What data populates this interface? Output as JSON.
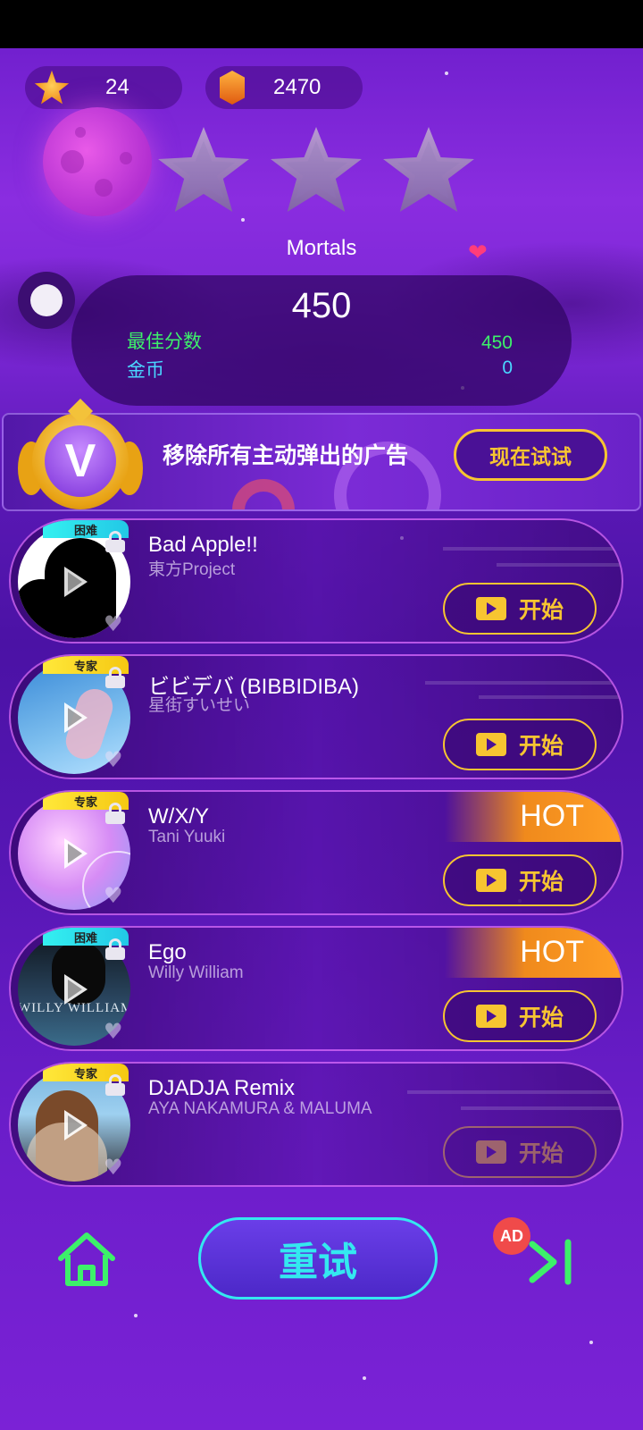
{
  "header": {
    "stars_count": "24",
    "gems_count": "2470",
    "stars_icon": "star-icon",
    "gems_icon": "gem-icon"
  },
  "level": {
    "song_title": "Mortals",
    "score": "450",
    "best_score_label": "最佳分数",
    "best_score_value": "450",
    "coins_label": "金币",
    "coins_value": "0",
    "stars_earned": 0,
    "stars_total": 3
  },
  "banner": {
    "badge_letter": "V",
    "text": "移除所有主动弹出的广告",
    "button_label": "现在试试"
  },
  "songs": [
    {
      "title": "Bad Apple!!",
      "artist": "東方Project",
      "difficulty": "困难",
      "difficulty_type": "hard",
      "button": "开始",
      "hot": ""
    },
    {
      "title": "ビビデバ (BIBBIDIBA)",
      "artist": "星街すいせい",
      "difficulty": "专家",
      "difficulty_type": "expert",
      "button": "开始",
      "hot": ""
    },
    {
      "title": "W/X/Y",
      "artist": "Tani Yuuki",
      "difficulty": "专家",
      "difficulty_type": "expert",
      "button": "开始",
      "hot": "HOT"
    },
    {
      "title": "Ego",
      "artist": "Willy William",
      "difficulty": "困难",
      "difficulty_type": "hard",
      "button": "开始",
      "hot": "HOT",
      "cover_text": "WILLY WILLIAM"
    },
    {
      "title": "DJADJA Remix",
      "artist": "AYA NAKAMURA & MALUMA",
      "difficulty": "专家",
      "difficulty_type": "expert",
      "button": "开始",
      "hot": ""
    }
  ],
  "footer": {
    "retry_label": "重试",
    "ad_badge": "AD",
    "home_icon": "home-icon",
    "skip_icon": "skip-next-icon"
  },
  "colors": {
    "accent_gold": "#f7c531",
    "accent_cyan": "#34e8f0",
    "best_score_green": "#3df06a",
    "coins_cyan": "#4ad6ff",
    "hot_orange": "#f08a1c"
  }
}
